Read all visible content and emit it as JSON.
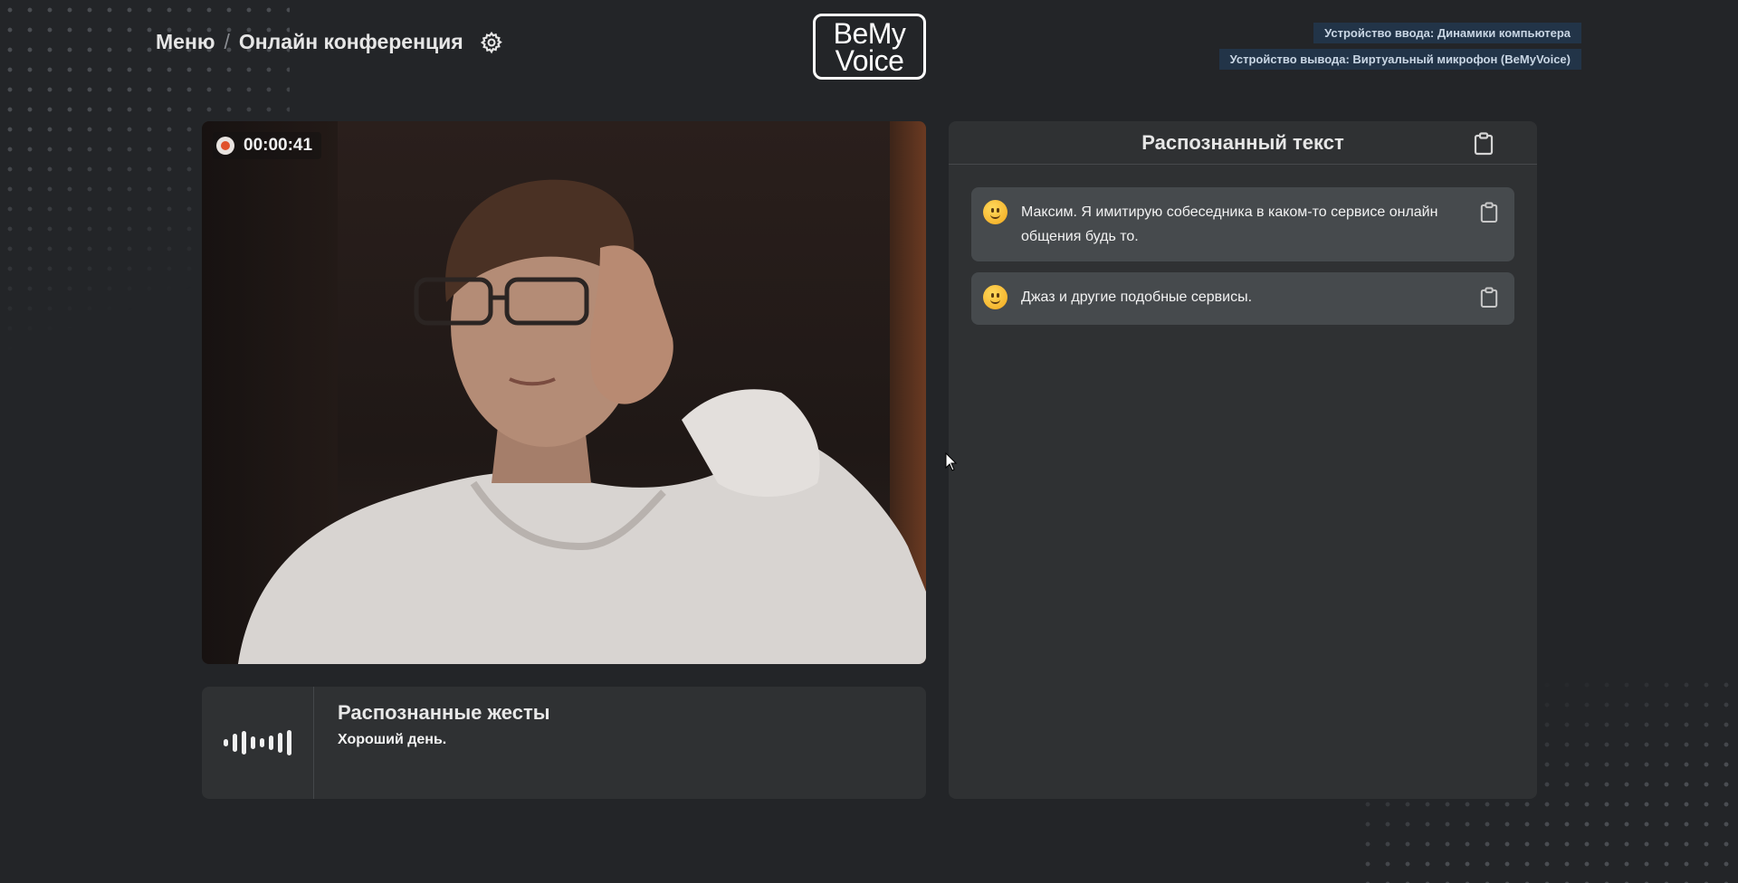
{
  "header": {
    "breadcrumb_menu": "Меню",
    "breadcrumb_separator": "/",
    "breadcrumb_page": "Онлайн конференция",
    "settings_icon": "gear-icon"
  },
  "logo": {
    "line1": "BeMy",
    "line2": "Voice"
  },
  "devices": {
    "input": "Устройство ввода: Динамики компьютера",
    "output": "Устройство вывода: Виртуальный микрофон (BeMyVoice)"
  },
  "video": {
    "timer": "00:00:41",
    "record_icon": "record-icon"
  },
  "gestures": {
    "title": "Распознанные жесты",
    "text": "Хороший день.",
    "icon": "waveform-icon"
  },
  "recognized": {
    "title": "Распознанный текст",
    "copy_icon": "clipboard-icon",
    "messages": [
      {
        "text": "Максим. Я имитирую собеседника в каком-то сервисе онлайн общения будь то.",
        "icon": "smile-emoji-icon"
      },
      {
        "text": "Джаз и другие подобные сервисы.",
        "icon": "smile-emoji-icon"
      }
    ]
  },
  "colors": {
    "background": "#232528",
    "panel": "#2f3133",
    "message": "#464a4d",
    "device_badge": "#223448",
    "record": "#e0512a"
  }
}
